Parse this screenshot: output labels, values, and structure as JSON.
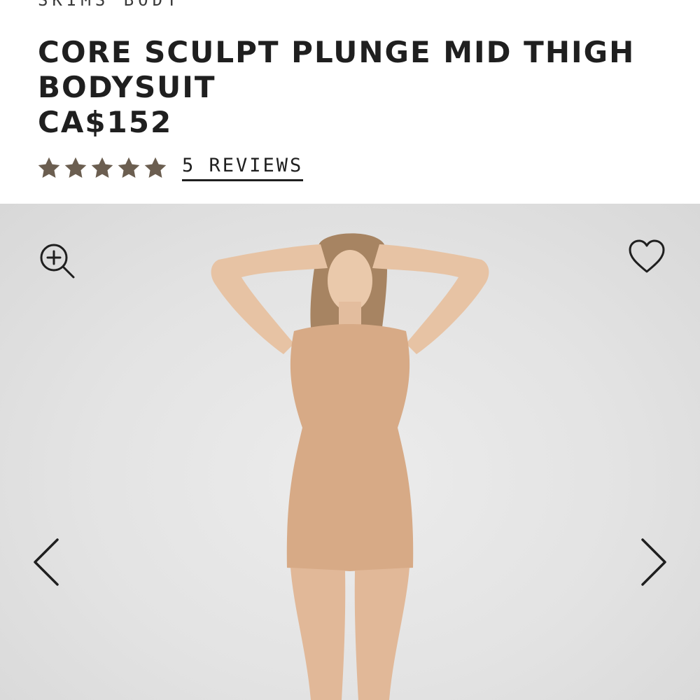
{
  "brand": {
    "name": "SKIMS BODY"
  },
  "product": {
    "title": "CORE SCULPT PLUNGE MID THIGH BODYSUIT",
    "price": "CA$152"
  },
  "rating": {
    "stars": 5,
    "max_stars": 5,
    "reviews_label": "5 REVIEWS",
    "star_color": "#6b5e50"
  },
  "gallery": {
    "background_color": "#e3e3e3",
    "image_alt": "Model wearing the bodysuit in a nude/sand colour, hands behind head",
    "garment_color": "#d7aa86",
    "icons": {
      "zoom": "zoom-in-icon",
      "favorite": "heart-icon",
      "previous": "chevron-left-icon",
      "next": "chevron-right-icon"
    }
  }
}
